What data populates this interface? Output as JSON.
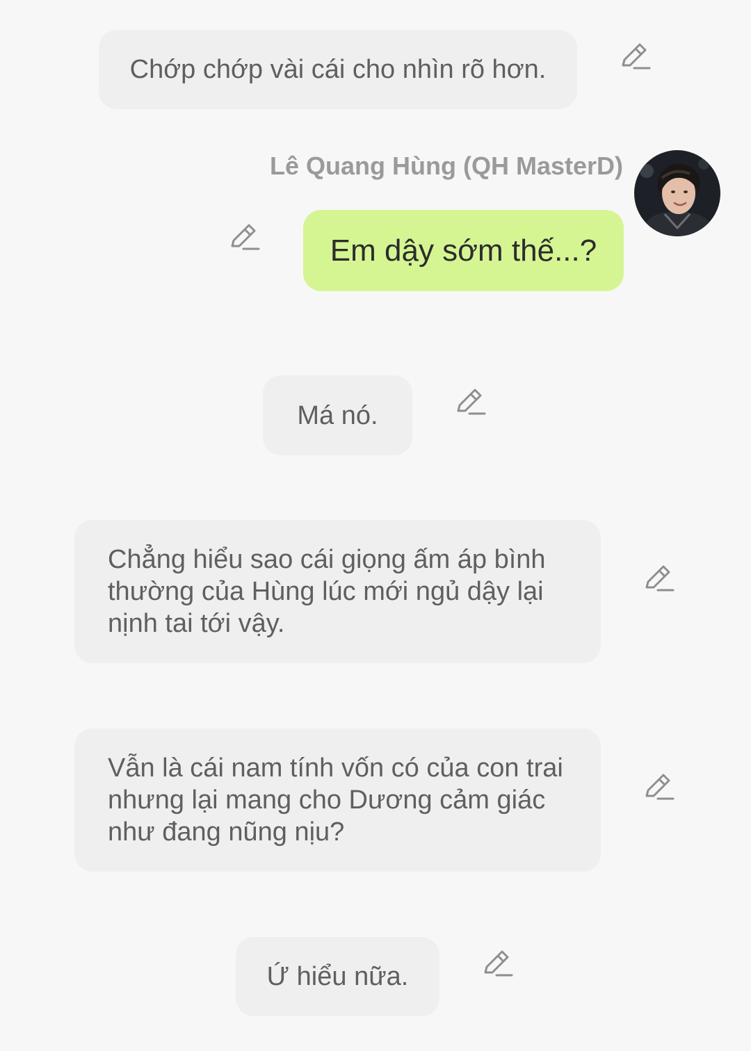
{
  "messages": [
    {
      "type": "narration",
      "text": "Chớp chớp vài cái cho nhìn rõ hơn."
    },
    {
      "type": "character",
      "sender": "Lê Quang Hùng (QH MasterD)",
      "text": "Em dậy sớm thế...?"
    },
    {
      "type": "narration",
      "text": "Má nó."
    },
    {
      "type": "narration",
      "text": "Chẳng hiểu sao cái giọng ấm áp bình thường của Hùng lúc mới ngủ dậy lại nịnh tai tới vậy."
    },
    {
      "type": "narration",
      "text": "Vẫn là cái nam tính vốn có của con trai nhưng lại mang cho Dương cảm giác như đang nũng nịu?"
    },
    {
      "type": "narration",
      "text": "Ứ hiểu nữa."
    }
  ],
  "icons": {
    "edit": "pencil-edit-icon",
    "avatar": "user-avatar"
  },
  "colors": {
    "background": "#f7f7f7",
    "narration_bubble": "#efefef",
    "speech_bubble": "#d5f593",
    "sender_name": "#9a9a9a",
    "icon": "#8e8e8e"
  }
}
